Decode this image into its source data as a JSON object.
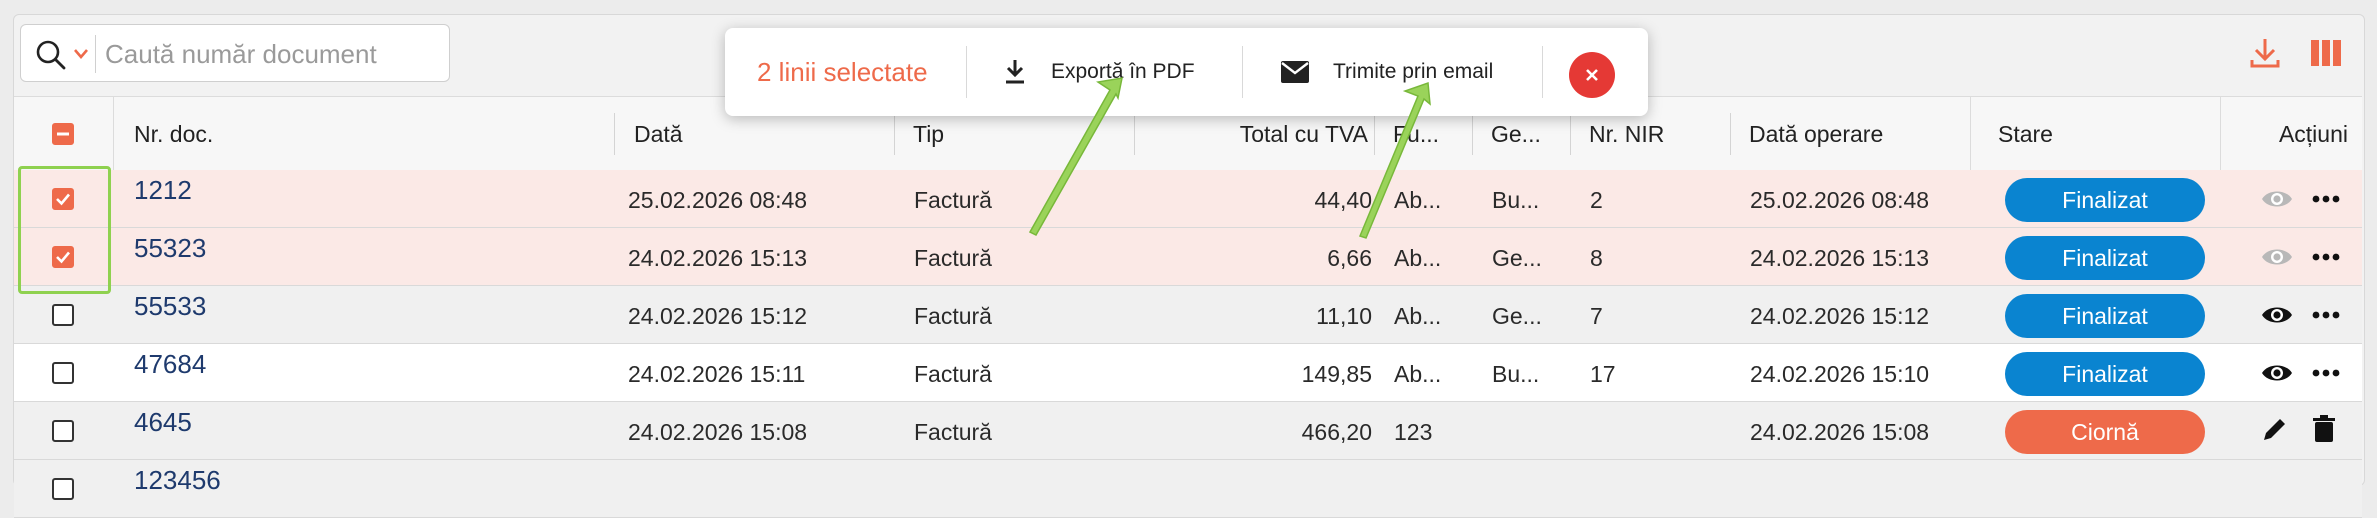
{
  "search": {
    "placeholder": "Caută număr document"
  },
  "toolbar": {
    "download_icon": "download-icon",
    "columns_icon": "columns-icon",
    "accent": "#ee6a4a"
  },
  "selection_bar": {
    "count_label": "2 linii selectate",
    "export_pdf_label": "Exportă în PDF",
    "email_label": "Trimite prin email"
  },
  "table": {
    "headers": {
      "doc": "Nr. doc.",
      "date": "Dată",
      "type": "Tip",
      "total": "Total cu TVA",
      "fu": "Fu...",
      "ge": "Ge...",
      "nir": "Nr. NIR",
      "opdate": "Dată operare",
      "status": "Stare",
      "actions": "Acțiuni"
    },
    "rows": [
      {
        "selected": true,
        "doc": "1212",
        "date": "25.02.2026 08:48",
        "type": "Factură",
        "total": "44,40",
        "fu": "Ab...",
        "ge": "Bu...",
        "nir": "2",
        "opdate": "25.02.2026 08:48",
        "status": "Finalizat",
        "status_color": "#0a84d0",
        "actions": [
          "eye-icon-disabled",
          "more-icon"
        ]
      },
      {
        "selected": true,
        "doc": "55323",
        "date": "24.02.2026 15:13",
        "type": "Factură",
        "total": "6,66",
        "fu": "Ab...",
        "ge": "Ge...",
        "nir": "8",
        "opdate": "24.02.2026 15:13",
        "status": "Finalizat",
        "status_color": "#0a84d0",
        "actions": [
          "eye-icon-disabled",
          "more-icon"
        ]
      },
      {
        "selected": false,
        "doc": "55533",
        "date": "24.02.2026 15:12",
        "type": "Factură",
        "total": "11,10",
        "fu": "Ab...",
        "ge": "Ge...",
        "nir": "7",
        "opdate": "24.02.2026 15:12",
        "status": "Finalizat",
        "status_color": "#0a84d0",
        "actions": [
          "eye-icon",
          "more-icon"
        ]
      },
      {
        "selected": false,
        "doc": "47684",
        "date": "24.02.2026 15:11",
        "type": "Factură",
        "total": "149,85",
        "fu": "Ab...",
        "ge": "Bu...",
        "nir": "17",
        "opdate": "24.02.2026 15:10",
        "status": "Finalizat",
        "status_color": "#0a84d0",
        "actions": [
          "eye-icon",
          "more-icon"
        ]
      },
      {
        "selected": false,
        "doc": "4645",
        "date": "24.02.2026 15:08",
        "type": "Factură",
        "total": "466,20",
        "fu": "123",
        "ge": "",
        "nir": "",
        "opdate": "24.02.2026 15:08",
        "status": "Ciornă",
        "status_color": "#ee6a4a",
        "actions": [
          "edit-icon",
          "delete-icon"
        ]
      },
      {
        "selected": false,
        "doc": "123456",
        "date": "",
        "type": "",
        "total": "",
        "fu": "",
        "ge": "",
        "nir": "",
        "opdate": "",
        "status": "",
        "status_color": "#0a84d0",
        "actions": []
      }
    ]
  },
  "annotation_color": "#8fd14f"
}
